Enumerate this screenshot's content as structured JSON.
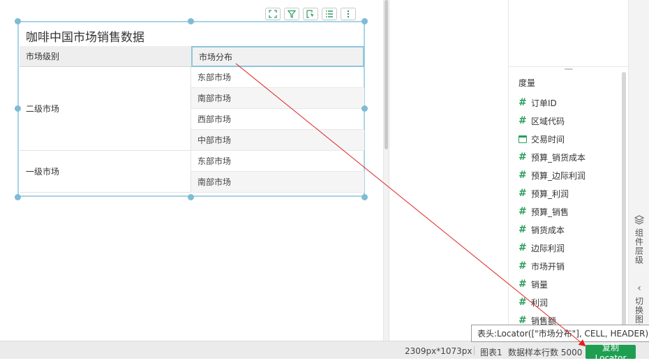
{
  "widget": {
    "title": "咖啡中国市场销售数据",
    "toolbar": [
      "expand",
      "filter",
      "select",
      "list",
      "more"
    ]
  },
  "table": {
    "headers": [
      "市场级别",
      "市场分布"
    ],
    "groups": [
      {
        "level": "二级市场",
        "rows": [
          "东部市场",
          "南部市场",
          "西部市场",
          "中部市场"
        ]
      },
      {
        "level": "一级市场",
        "rows": [
          "东部市场",
          "南部市场"
        ]
      }
    ]
  },
  "fields": {
    "section_title": "度量",
    "items": [
      {
        "label": "订单ID",
        "icon": "hash-icon"
      },
      {
        "label": "区域代码",
        "icon": "hash-icon"
      },
      {
        "label": "交易时间",
        "icon": "calendar-icon"
      },
      {
        "label": "预算_销货成本",
        "icon": "hash-icon"
      },
      {
        "label": "预算_边际利润",
        "icon": "hash-icon"
      },
      {
        "label": "预算_利润",
        "icon": "hash-icon"
      },
      {
        "label": "预算_销售",
        "icon": "hash-icon"
      },
      {
        "label": "销货成本",
        "icon": "hash-icon"
      },
      {
        "label": "边际利润",
        "icon": "hash-icon"
      },
      {
        "label": "市场开销",
        "icon": "hash-icon"
      },
      {
        "label": "销量",
        "icon": "hash-icon"
      },
      {
        "label": "利润",
        "icon": "hash-icon"
      },
      {
        "label": "销售额",
        "icon": "hash-icon"
      }
    ]
  },
  "side_rail": {
    "layers_label": "组件层级",
    "switch_label": "切换图表"
  },
  "status_bar": {
    "canvas_size": "2309px*1073px",
    "chart_name": "图表1",
    "sample_rows": "数据样本行数 5000",
    "copy_button": "复制Locator"
  },
  "tooltip": {
    "text": "表头:Locator([\"市场分布\"], CELL, HEADER)"
  },
  "colors": {
    "accent_green": "#1f9e52",
    "field_hash": "#2a9d5c",
    "selection_border": "#a8d3e6",
    "arrow": "#e02020"
  }
}
